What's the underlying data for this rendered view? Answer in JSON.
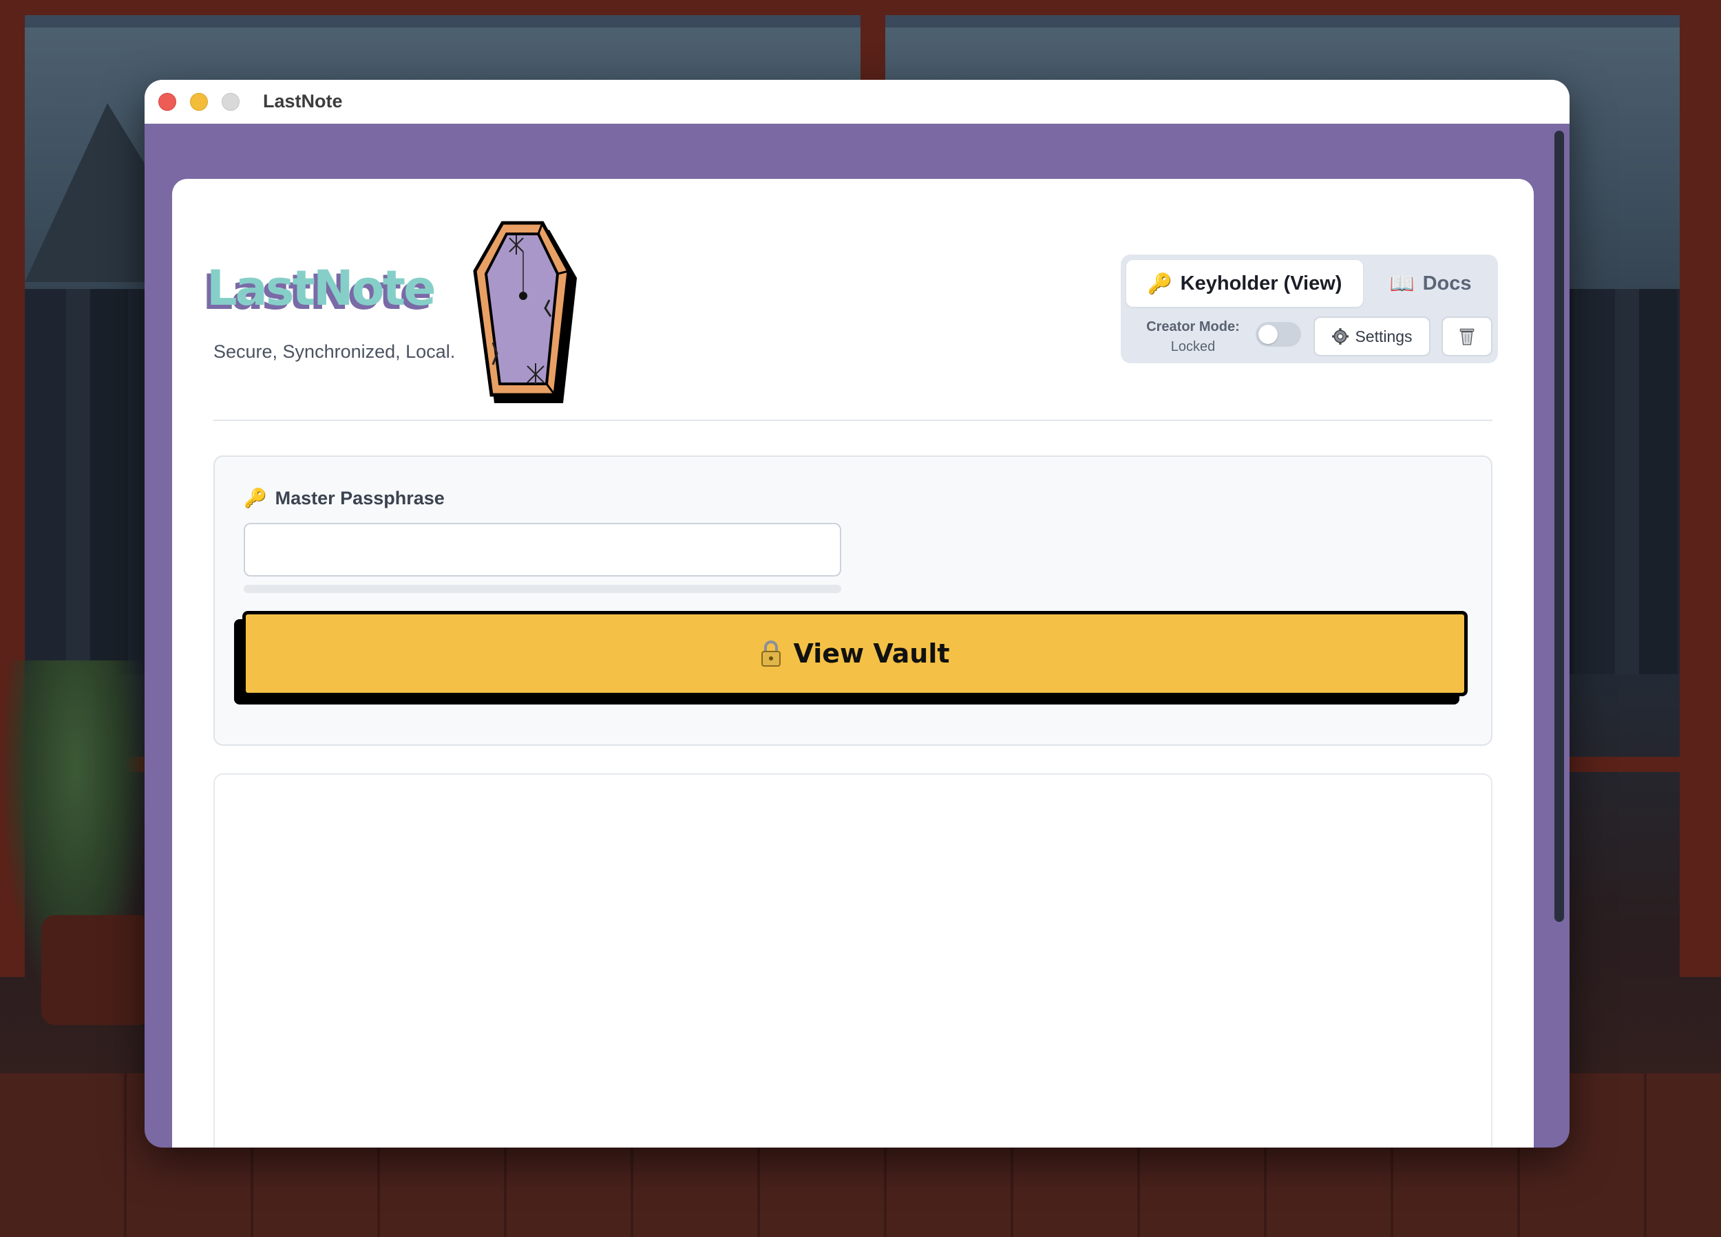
{
  "window": {
    "title": "LastNote"
  },
  "header": {
    "logo_text": "LastNote",
    "tagline": "Secure, Synchronized, Local."
  },
  "tabs": [
    {
      "label": "Keyholder (View)",
      "icon": "key-icon",
      "active": true
    },
    {
      "label": "Docs",
      "icon": "book-icon",
      "active": false
    }
  ],
  "creator_mode": {
    "label": "Creator Mode:",
    "state": "Locked",
    "enabled": false
  },
  "toolbar": {
    "settings_label": "Settings",
    "settings_icon": "gear-icon",
    "trash_icon": "trash-icon"
  },
  "passphrase": {
    "label": "Master Passphrase",
    "icon": "key-icon",
    "value": "",
    "strength": 0
  },
  "actions": {
    "view_vault_label": "View Vault",
    "view_vault_icon": "lock-icon"
  },
  "colors": {
    "accent": "#7a69a3",
    "button": "#f4c146",
    "logo": "#86cfc9"
  }
}
